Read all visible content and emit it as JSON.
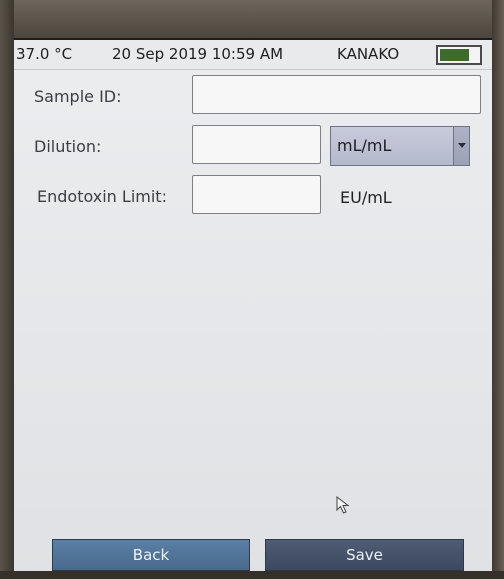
{
  "status_bar": {
    "temperature": "37.0 °C",
    "datetime": "20 Sep 2019 10:59 AM",
    "user": "KANAKO",
    "battery_level": 0.7
  },
  "form": {
    "sample_id": {
      "label": "Sample ID:",
      "value": ""
    },
    "dilution": {
      "label": "Dilution:",
      "value": "",
      "unit_selected": "mL/mL"
    },
    "endotoxin_limit": {
      "label": "Endotoxin Limit:",
      "value": "",
      "unit": "EU/mL"
    }
  },
  "buttons": {
    "back": "Back",
    "save": "Save"
  },
  "icons": {
    "battery": "battery-icon",
    "dropdown": "chevron-down-icon",
    "cursor": "mouse-pointer-icon"
  }
}
